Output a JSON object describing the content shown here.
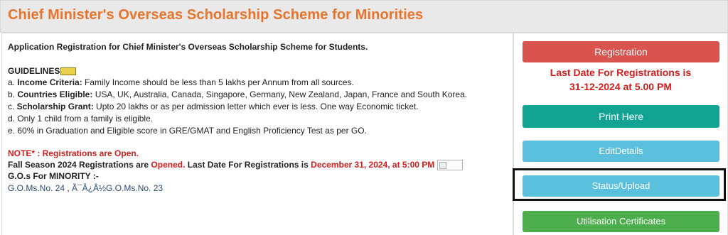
{
  "header": {
    "title": "Chief Minister's Overseas Scholarship Scheme for Minorities"
  },
  "main": {
    "intro": "Application Registration for Chief Minister's Overseas Scholarship Scheme for Students.",
    "guidelines_heading": "GUIDELINES",
    "guidelines": [
      {
        "prefix": "a. ",
        "label": "Income Criteria:",
        "text": " Family Income should be less than 5 lakhs per Annum from all sources."
      },
      {
        "prefix": "b. ",
        "label": "Countries Eligible:",
        "text": " USA, UK, Australia, Canada, Singapore, Germany, New Zealand, Japan, France and South Korea."
      },
      {
        "prefix": "c. ",
        "label": "Scholarship Grant:",
        "text": " Upto 20 lakhs or as per admission letter which ever is less. One way Economic ticket."
      },
      {
        "prefix": "d. ",
        "label": "",
        "text": "Only 1 child from a family is eligible."
      },
      {
        "prefix": "e. ",
        "label": "",
        "text": "60% in Graduation and Eligible score in GRE/GMAT and English Proficiency Test as per GO."
      }
    ],
    "note": "NOTE* : Registrations are Open.",
    "fall_prefix": "Fall Season 2024 Registrations are ",
    "fall_opened": "Opened.",
    "fall_mid": " Last Date For Registrations is ",
    "fall_date": "December 31, 2024, at 5:00 PM",
    "gos_heading": "G.O.s For MINORITY :-",
    "go_link_1": "G.O.Ms.No. 24",
    "go_sep": " , ",
    "go_link_2": "Ã¯Â¿Â½G.O.Ms.No. 23"
  },
  "sidebar": {
    "registration_label": "Registration",
    "deadline_line1": "Last Date For Registrations is",
    "deadline_line2": "31-12-2024 at 5.00 PM",
    "print_label": "Print Here",
    "edit_label": "EditDetails",
    "status_label": "Status/Upload",
    "utilisation_label": "Utilisation Certificates"
  },
  "colors": {
    "title_orange": "#e8742c",
    "red": "#d41c1c",
    "btn_red": "#d9534f",
    "btn_teal": "#12a393",
    "btn_blue": "#5bc0de",
    "btn_green": "#4cae4c"
  }
}
